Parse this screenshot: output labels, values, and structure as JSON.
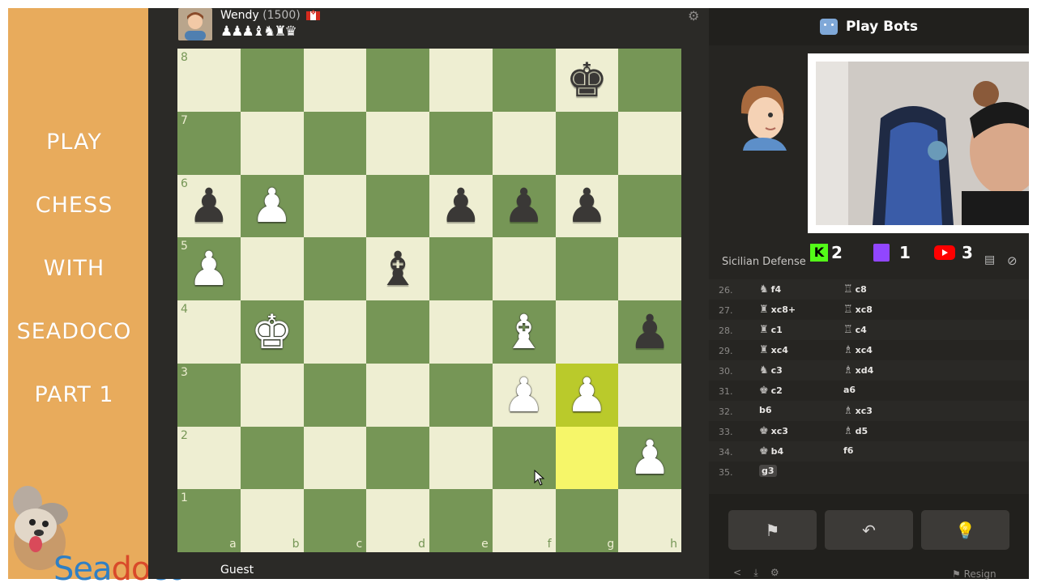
{
  "left_panel": {
    "title_lines": [
      "PLAY",
      "CHESS",
      "WITH",
      "SEADOCO",
      "PART 1"
    ],
    "brand": {
      "s": "Sea",
      "d": "do",
      "c": "co"
    },
    "color": "#e8ab5c"
  },
  "opponent": {
    "name": "Wendy",
    "rating": "(1500)",
    "captured": "♟♟♟♝♞♜♛",
    "settings_icon": "gear-icon"
  },
  "bottom_player": {
    "name": "Guest"
  },
  "board": {
    "light": "#eeeed2",
    "dark": "#769656",
    "ranks": [
      "8",
      "7",
      "6",
      "5",
      "4",
      "3",
      "2",
      "1"
    ],
    "files": [
      "a",
      "b",
      "c",
      "d",
      "e",
      "f",
      "g",
      "h"
    ],
    "pieces": [
      {
        "square": "g8",
        "glyph": "♚",
        "color": "black"
      },
      {
        "square": "a6",
        "glyph": "♟",
        "color": "black"
      },
      {
        "square": "b6",
        "glyph": "♟",
        "color": "white"
      },
      {
        "square": "e6",
        "glyph": "♟",
        "color": "black"
      },
      {
        "square": "f6",
        "glyph": "♟",
        "color": "black"
      },
      {
        "square": "g6",
        "glyph": "♟",
        "color": "black"
      },
      {
        "square": "a5",
        "glyph": "♟",
        "color": "white"
      },
      {
        "square": "d5",
        "glyph": "♝",
        "color": "black"
      },
      {
        "square": "b4",
        "glyph": "♚",
        "color": "white"
      },
      {
        "square": "f4",
        "glyph": "♝",
        "color": "white"
      },
      {
        "square": "h4",
        "glyph": "♟",
        "color": "black"
      },
      {
        "square": "f3",
        "glyph": "♟",
        "color": "white"
      },
      {
        "square": "g3",
        "glyph": "♟",
        "color": "white"
      },
      {
        "square": "h2",
        "glyph": "♟",
        "color": "white"
      }
    ],
    "highlighted": [
      "g3",
      "g2"
    ]
  },
  "right_panel": {
    "header": "Play Bots",
    "opening": "Sicilian Defense",
    "counters": {
      "kick": "2",
      "twitch": "1",
      "youtube": "3"
    },
    "moves": [
      {
        "num": "26.",
        "white_glyph": "♞",
        "white": "f4",
        "black_glyph": "♖",
        "black": "c8"
      },
      {
        "num": "27.",
        "white_glyph": "♜",
        "white": "xc8+",
        "black_glyph": "♖",
        "black": "xc8"
      },
      {
        "num": "28.",
        "white_glyph": "♜",
        "white": "c1",
        "black_glyph": "♖",
        "black": "c4"
      },
      {
        "num": "29.",
        "white_glyph": "♜",
        "white": "xc4",
        "black_glyph": "♗",
        "black": "xc4"
      },
      {
        "num": "30.",
        "white_glyph": "♞",
        "white": "c3",
        "black_glyph": "♗",
        "black": "xd4"
      },
      {
        "num": "31.",
        "white_glyph": "♚",
        "white": "c2",
        "black_glyph": "",
        "black": "a6"
      },
      {
        "num": "32.",
        "white_glyph": "",
        "white": "b6",
        "black_glyph": "♗",
        "black": "xc3"
      },
      {
        "num": "33.",
        "white_glyph": "♚",
        "white": "xc3",
        "black_glyph": "♗",
        "black": "d5"
      },
      {
        "num": "34.",
        "white_glyph": "♚",
        "white": "b4",
        "black_glyph": "",
        "black": "f6"
      },
      {
        "num": "35.",
        "white_glyph": "",
        "white": "g3",
        "black_glyph": "",
        "black": ""
      }
    ],
    "controls": [
      {
        "name": "flag-icon",
        "glyph": "⚑"
      },
      {
        "name": "undo-icon",
        "glyph": "↶"
      },
      {
        "name": "hint-bulb-icon",
        "glyph": "💡"
      }
    ],
    "resign": "Resign"
  }
}
